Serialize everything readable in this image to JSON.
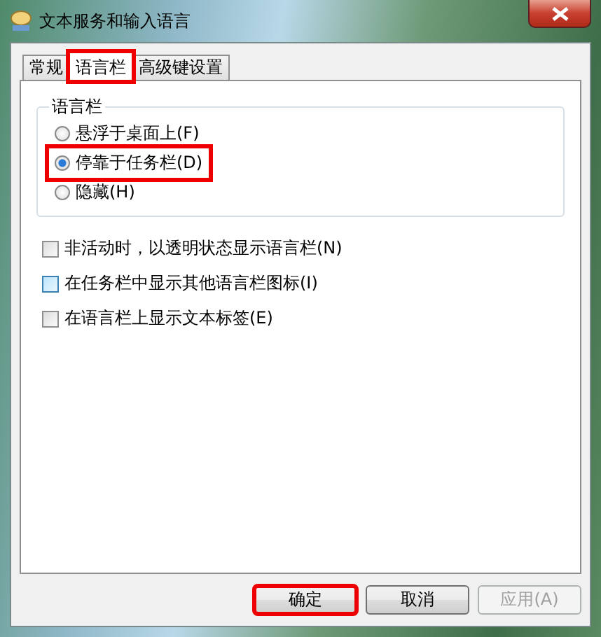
{
  "window": {
    "title": "文本服务和输入语言"
  },
  "tabs": [
    {
      "label": "常规",
      "selected": false,
      "highlighted": false
    },
    {
      "label": "语言栏",
      "selected": true,
      "highlighted": true
    },
    {
      "label": "高级键设置",
      "selected": false,
      "highlighted": false
    }
  ],
  "group": {
    "title": "语言栏",
    "options": [
      {
        "label": "悬浮于桌面上(F)",
        "selected": false,
        "highlighted": false
      },
      {
        "label": "停靠于任务栏(D)",
        "selected": true,
        "highlighted": true
      },
      {
        "label": "隐藏(H)",
        "selected": false,
        "highlighted": false
      }
    ]
  },
  "checkboxes": [
    {
      "label": "非活动时，以透明状态显示语言栏(N)",
      "checked": false,
      "hovered": false
    },
    {
      "label": "在任务栏中显示其他语言栏图标(I)",
      "checked": false,
      "hovered": true
    },
    {
      "label": "在语言栏上显示文本标签(E)",
      "checked": false,
      "hovered": false
    }
  ],
  "buttons": [
    {
      "label": "确定",
      "disabled": false,
      "highlighted": true
    },
    {
      "label": "取消",
      "disabled": false,
      "highlighted": false
    },
    {
      "label": "应用(A)",
      "disabled": true,
      "highlighted": false
    }
  ]
}
